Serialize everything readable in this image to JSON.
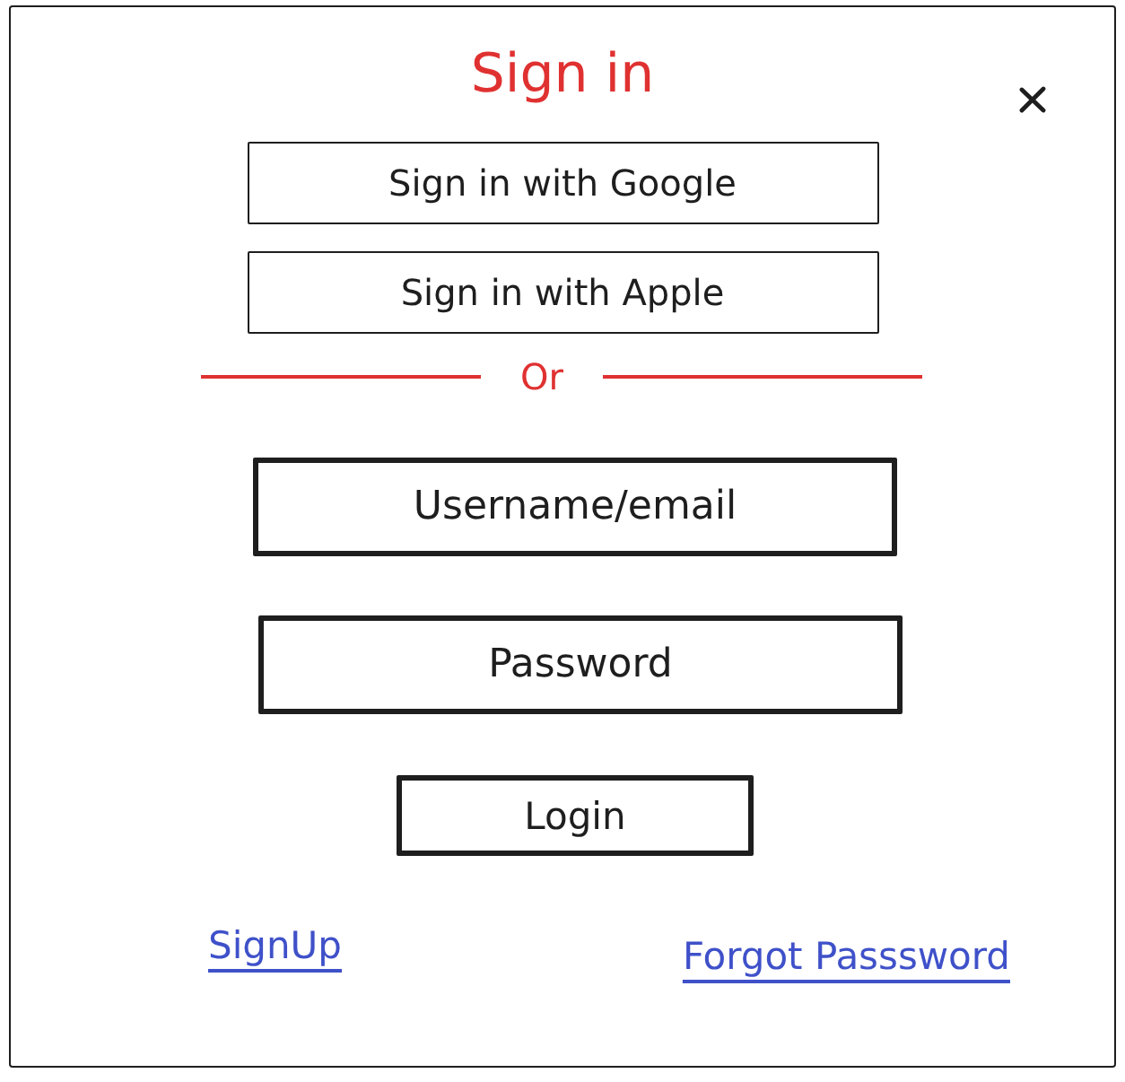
{
  "title": "Sign in",
  "social_buttons": [
    {
      "label": "Sign in with Google"
    },
    {
      "label": "Sign in with Apple"
    }
  ],
  "divider": {
    "label": "Or"
  },
  "fields": [
    {
      "placeholder": "Username/email"
    },
    {
      "placeholder": "Password"
    }
  ],
  "login_button": {
    "label": "Login"
  },
  "links": [
    {
      "label": "SignUp"
    },
    {
      "label": "Forgot Passsword"
    }
  ]
}
